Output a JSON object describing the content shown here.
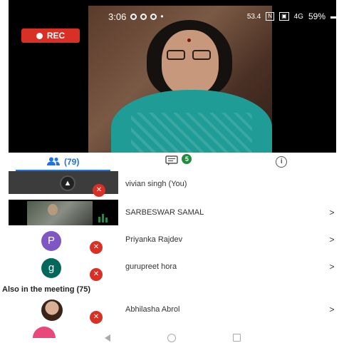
{
  "status_bar": {
    "time": "3:06",
    "network_speed": "53.4",
    "signal_label": "4G",
    "battery": "59%"
  },
  "recording": {
    "label": "REC"
  },
  "tabs": {
    "people_count": "(79)",
    "chat_badge": "5"
  },
  "participants": [
    {
      "name": "vivian singh (You)",
      "muted": true,
      "has_chevron": false
    },
    {
      "name": "SARBESWAR SAMAL",
      "muted": false,
      "has_chevron": true
    },
    {
      "name": "Priyanka Rajdev",
      "avatar_letter": "P",
      "avatar_color": "#7e57c2",
      "muted": true,
      "has_chevron": true
    },
    {
      "name": "gurupreet hora",
      "avatar_letter": "g",
      "avatar_color": "#00695c",
      "muted": true,
      "has_chevron": true
    }
  ],
  "also_in_meeting": {
    "title": "Also in the meeting (75)",
    "items": [
      {
        "name": "Abhilasha Abrol",
        "muted": true,
        "has_chevron": true
      }
    ]
  },
  "chevron": ">",
  "colors": {
    "accent": "#1a73e8",
    "rec": "#d93025",
    "badge": "#1e8e3e"
  }
}
